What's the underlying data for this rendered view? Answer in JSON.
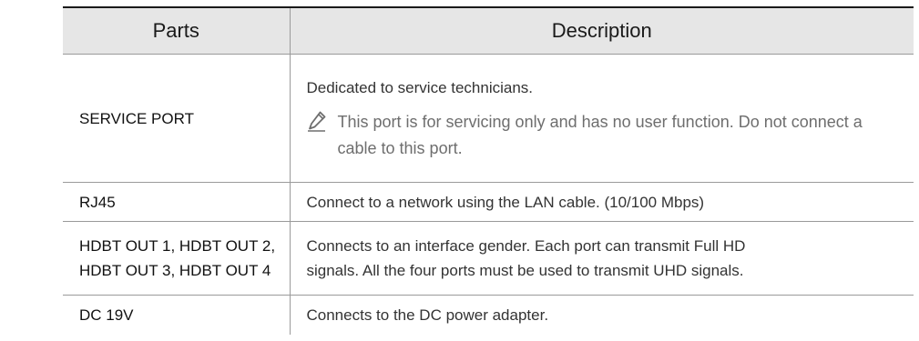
{
  "table": {
    "headers": {
      "parts": "Parts",
      "description": "Description"
    },
    "rows": [
      {
        "part_lines": [
          "SERVICE PORT"
        ],
        "desc_lines": [
          "Dedicated to service technicians."
        ],
        "note": "This port is for servicing only and has no user function. Do not connect a cable to this port.",
        "note_icon": "pencil-note-icon"
      },
      {
        "part_lines": [
          "RJ45"
        ],
        "desc_lines": [
          "Connect to a network using the LAN cable. (10/100 Mbps)"
        ]
      },
      {
        "part_lines": [
          "HDBT OUT 1, HDBT OUT 2,",
          "HDBT OUT 3, HDBT OUT 4"
        ],
        "desc_lines": [
          "Connects to an interface gender. Each port can transmit Full HD",
          "signals. All the four ports must be used to transmit UHD signals."
        ]
      },
      {
        "part_lines": [
          "DC 19V"
        ],
        "desc_lines": [
          "Connects to the DC power adapter."
        ]
      }
    ]
  },
  "colors": {
    "header_bg": "#e6e6e6",
    "note_text": "#6e6e6e",
    "border": "#9a9a9a"
  }
}
